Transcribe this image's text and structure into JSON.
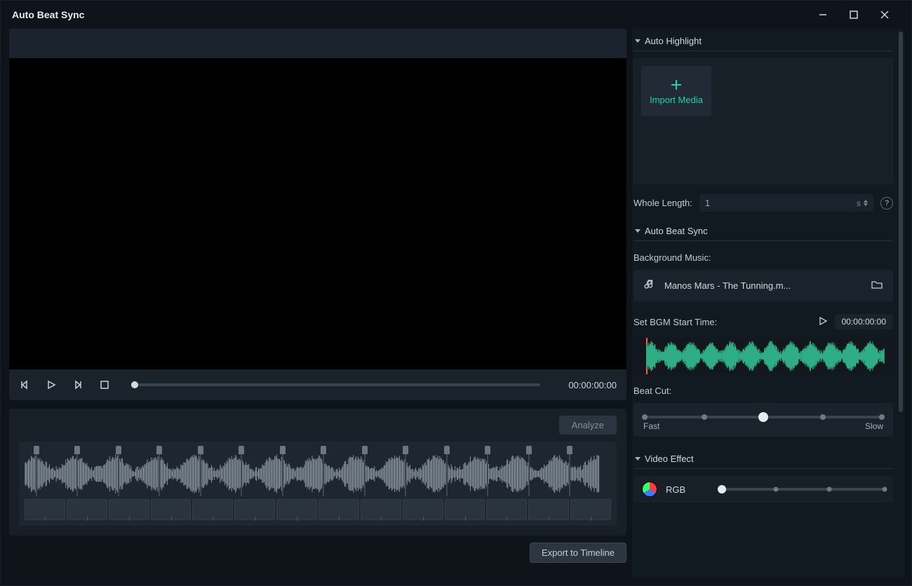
{
  "window": {
    "title": "Auto Beat Sync"
  },
  "preview": {
    "timecode": "00:00:00:00"
  },
  "timeline": {
    "analyze_label": "Analyze",
    "export_label": "Export to Timeline"
  },
  "right_panel": {
    "auto_highlight": {
      "header": "Auto Highlight",
      "import_label": "Import Media",
      "whole_length_label": "Whole Length:",
      "whole_length_value": "1",
      "whole_length_unit": "s"
    },
    "auto_beat_sync": {
      "header": "Auto Beat Sync",
      "bg_music_label": "Background Music:",
      "track_name": "Manos Mars - The Tunning.m...",
      "set_bgm_label": "Set BGM Start Time:",
      "bgm_time": "00:00:00:00",
      "beat_cut_label": "Beat Cut:",
      "beat_cut_fast": "Fast",
      "beat_cut_slow": "Slow",
      "beat_cut_value": 2,
      "beat_cut_ticks": 5
    },
    "video_effect": {
      "header": "Video Effect",
      "effects": [
        {
          "name": "RGB",
          "value": 0,
          "ticks": 4
        }
      ]
    }
  }
}
